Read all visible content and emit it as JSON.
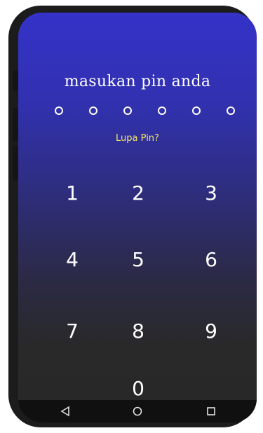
{
  "screen": {
    "prompt": "masukan pin anda",
    "pin_length": 6,
    "pin_entered": 0,
    "forgot_label": "Lupa Pin?"
  },
  "keypad": {
    "keys": [
      "1",
      "2",
      "3",
      "4",
      "5",
      "6",
      "7",
      "8",
      "9",
      "0"
    ]
  },
  "navbar": {
    "icons": [
      "back-icon",
      "home-icon",
      "recents-icon"
    ]
  },
  "colors": {
    "gradient_top": "#3432c8",
    "gradient_bottom": "#282828",
    "accent_link": "#f3e46b",
    "frame": "#1c1c1c"
  }
}
